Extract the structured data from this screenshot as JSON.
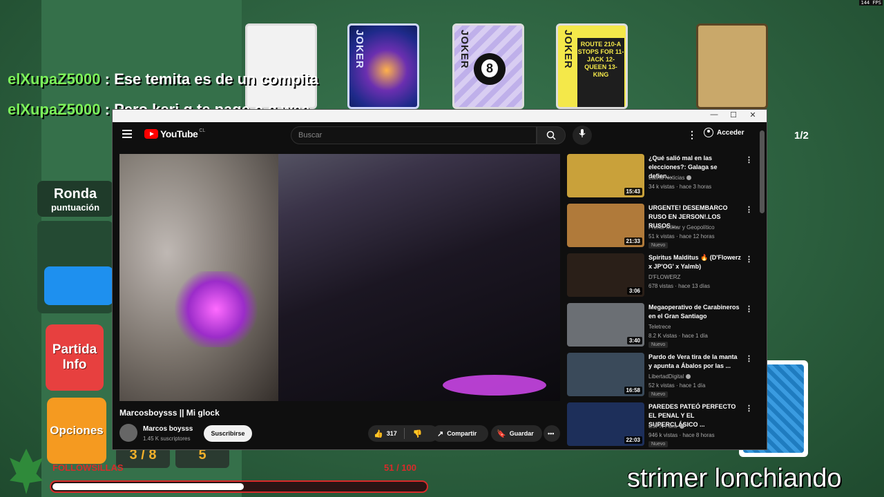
{
  "overlay": {
    "fps": "144 FPS",
    "chat": [
      {
        "user": "elXupaZ5000",
        "message": ": Ese temita es de un compita"
      },
      {
        "user": "elXupaZ5000",
        "message": ": Pero keri q te page o q wea"
      }
    ],
    "score": {
      "line1": "Ronda",
      "line2": "puntuación"
    },
    "partida_btn": {
      "line1": "Partida",
      "line2": "Info"
    },
    "opciones_btn": "Opciones",
    "small_boxes": [
      "3 / 8",
      "5"
    ],
    "follow_label": "FOLLOWSILLAS",
    "follow_count": "51 / 100",
    "follow_progress": 0.51,
    "page_count": "1/2",
    "strimer": "strimer lonchiando"
  },
  "jokers": [
    {
      "label": ""
    },
    {
      "label": "JOKER"
    },
    {
      "label": "JOKER",
      "ball": "8"
    },
    {
      "label": "JOKER",
      "sign": "ROUTE 210-A STOPS FOR 11-JACK 12-QUEEN 13-KING"
    },
    {
      "label": ""
    }
  ],
  "window": {
    "controls": {
      "min": "—",
      "max": "☐",
      "close": "✕"
    }
  },
  "youtube": {
    "logo": "YouTube",
    "country": "CL",
    "search_placeholder": "Buscar",
    "signin": "Acceder",
    "video": {
      "title": "Marcosboysss || Mi glock",
      "channel": "Marcos boysss",
      "subscribers": "1.45 K suscriptores",
      "subscribe": "Suscribirse",
      "likes": "317",
      "share": "Compartir",
      "save": "Guardar"
    },
    "recommendations": [
      {
        "title": "¿Qué salió mal en las elecciones?: Galaga se defien...",
        "channel": "Latina Noticias",
        "verified": true,
        "meta": "34 k vistas · hace 3 horas",
        "duration": "15:43",
        "badge": "",
        "thumb_color": "#c9a13a"
      },
      {
        "title": "URGENTE! DESEMBARCO RUSO EN JERSON!.LOS RUSOS ...",
        "channel": "Frente Militar y Geopolítico",
        "verified": false,
        "meta": "51 k vistas · hace 12 horas",
        "duration": "21:33",
        "badge": "Nuevo",
        "thumb_color": "#b07a3a"
      },
      {
        "title": "Spiritus Malditus 🔥 (D'Flowerz x JP'OG' x Yalmb)",
        "channel": "D'FLOWERZ",
        "verified": false,
        "meta": "678 vistas · hace 13 días",
        "duration": "3:06",
        "badge": "",
        "thumb_color": "#2a1f18"
      },
      {
        "title": "Megaoperativo de Carabineros en el Gran Santiago",
        "channel": "Teletrece",
        "verified": false,
        "meta": "8.2 K vistas · hace 1 día",
        "duration": "3:40",
        "badge": "Nuevo",
        "thumb_color": "#6b6f74"
      },
      {
        "title": "Pardo de Vera tira de la manta y apunta a Ábalos por las ...",
        "channel": "LibertadDigital",
        "verified": true,
        "meta": "52 k vistas · hace 1 día",
        "duration": "16:58",
        "badge": "Nuevo",
        "thumb_color": "#3a4a5a"
      },
      {
        "title": "PAREDES PATEÓ PERFECTO EL PENAL Y EL SUPERCLÁSICO ...",
        "channel": "ESPN Fans",
        "verified": true,
        "meta": "946 k vistas · hace 8 horas",
        "duration": "22:03",
        "badge": "Nuevo",
        "thumb_color": "#1d2f5a"
      }
    ]
  }
}
